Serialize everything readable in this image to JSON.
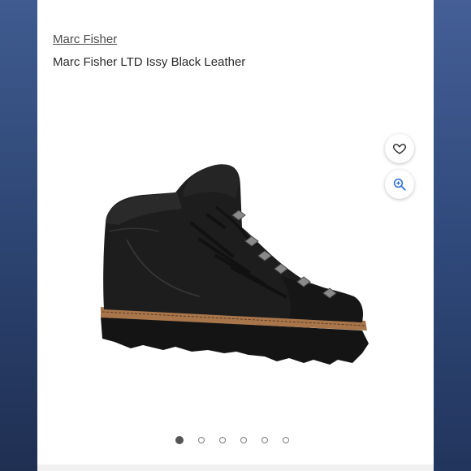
{
  "product": {
    "brand": "Marc Fisher",
    "title": "Marc Fisher LTD Issy Black Leather"
  },
  "actions": {
    "wishlist_icon": "heart-outline",
    "zoom_icon": "zoom-in",
    "accent_color": "#2b6cd4"
  },
  "gallery": {
    "image_count": 6,
    "active_index": 0
  }
}
